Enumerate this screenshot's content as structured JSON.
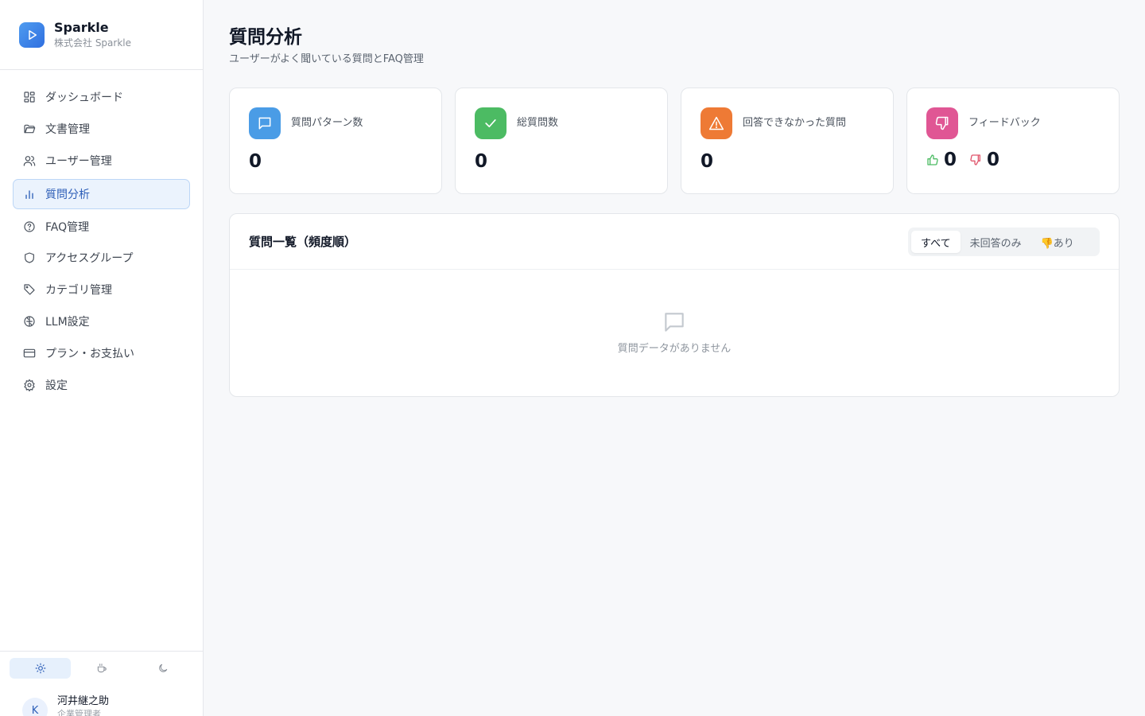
{
  "brand": {
    "name": "Sparkle",
    "company": "株式会社 Sparkle"
  },
  "sidebar": {
    "items": [
      {
        "label": "ダッシュボード",
        "icon": "dashboard-icon",
        "active": false
      },
      {
        "label": "文書管理",
        "icon": "folder-icon",
        "active": false
      },
      {
        "label": "ユーザー管理",
        "icon": "users-icon",
        "active": false
      },
      {
        "label": "質問分析",
        "icon": "bar-chart-icon",
        "active": true
      },
      {
        "label": "FAQ管理",
        "icon": "help-circle-icon",
        "active": false
      },
      {
        "label": "アクセスグループ",
        "icon": "shield-icon",
        "active": false
      },
      {
        "label": "カテゴリ管理",
        "icon": "tag-icon",
        "active": false
      },
      {
        "label": "LLM設定",
        "icon": "brain-icon",
        "active": false
      },
      {
        "label": "プラン・お支払い",
        "icon": "credit-card-icon",
        "active": false
      },
      {
        "label": "設定",
        "icon": "gear-icon",
        "active": false
      }
    ],
    "theme_options": [
      "sun-icon",
      "coffee-icon",
      "moon-icon"
    ],
    "active_theme": "sun-icon"
  },
  "user": {
    "initial": "K",
    "name": "河井継之助",
    "role": "企業管理者"
  },
  "page": {
    "title": "質問分析",
    "subtitle": "ユーザーがよく聞いている質問とFAQ管理"
  },
  "stats": [
    {
      "label": "質問パターン数",
      "value": "0",
      "icon": "message-square-icon",
      "color": "#4a9ce6"
    },
    {
      "label": "総質問数",
      "value": "0",
      "icon": "check-icon",
      "color": "#4cbb63"
    },
    {
      "label": "回答できなかった質問",
      "value": "0",
      "icon": "alert-triangle-icon",
      "color": "#ee7a35"
    },
    {
      "label": "フィードバック",
      "icon": "thumbs-down-icon",
      "color": "#e05694",
      "likes": "0",
      "dislikes": "0"
    }
  ],
  "question_list": {
    "title": "質問一覧（頻度順）",
    "filters": [
      "すべて",
      "未回答のみ",
      "👎あり"
    ],
    "active_filter": "すべて",
    "empty_text": "質問データがありません"
  },
  "colors": {
    "accent": "#2e5fb8",
    "active_bg": "#ebf3fd"
  }
}
